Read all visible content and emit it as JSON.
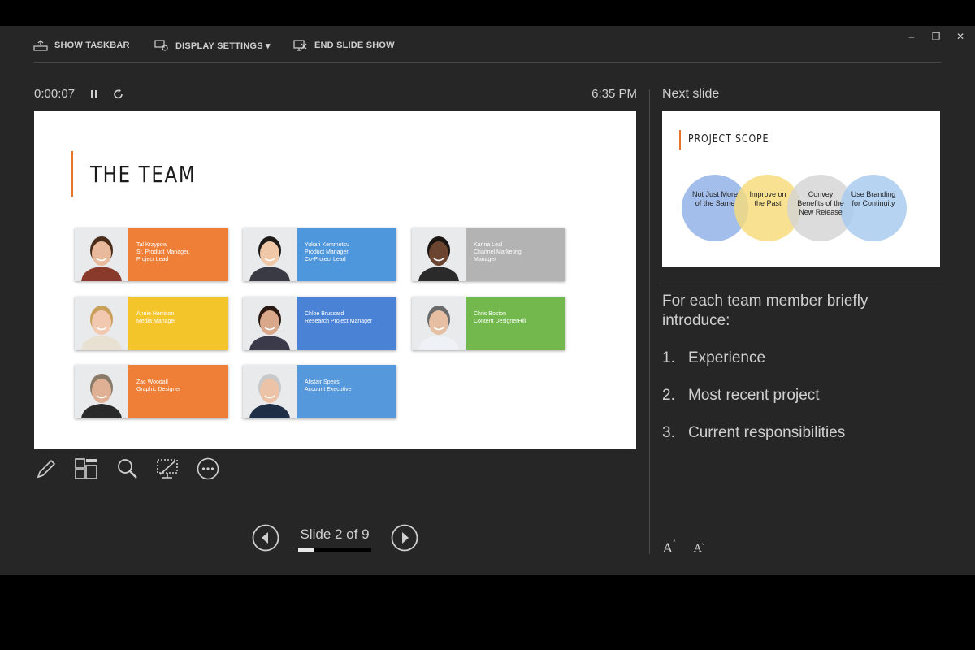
{
  "toolbar": {
    "show_taskbar": "SHOW TASKBAR",
    "display_settings": "DISPLAY SETTINGS ▾",
    "end_slide_show": "END SLIDE SHOW",
    "window_controls": [
      "–",
      "❐",
      "✕"
    ]
  },
  "presenter": {
    "timer": "0:00:07",
    "clock": "6:35 PM",
    "slide_counter": "Slide 2 of 9",
    "progress_fraction": 0.22
  },
  "current_slide": {
    "title": "THE TEAM",
    "accent_color": "#e8742c",
    "members": [
      {
        "text": "Tal Krzypow\nSr. Product Manager,\nProject Lead",
        "color": "#ef7f36"
      },
      {
        "text": "Yukari Kemmotsu\nProduct Manager,\nCo-Project Lead",
        "color": "#4f97dc"
      },
      {
        "text": "Karina Leal\nChannel Marketing\nManager",
        "color": "#b3b3b3"
      },
      {
        "text": "Annie Herrison\nMedia Manager",
        "color": "#f4c52a"
      },
      {
        "text": "Chloe Brussard\nResearch Project Manager",
        "color": "#4a82d6"
      },
      {
        "text": "Chris Boston\nContent DesignerHill",
        "color": "#72b84c"
      },
      {
        "text": "Zac Woodall\nGraphic Designer",
        "color": "#ef7f36"
      },
      {
        "text": "Alistair Speirs\nAccount Executive",
        "color": "#5598dc"
      }
    ]
  },
  "next_slide": {
    "label": "Next slide",
    "title": "PROJECT SCOPE",
    "circles": [
      {
        "text": "Not Just More of the Same",
        "color": "#8fb0e6"
      },
      {
        "text": "Improve on the Past",
        "color": "#f7dc7a"
      },
      {
        "text": "Convey Benefits of the New Release",
        "color": "#d4d4d4"
      },
      {
        "text": "Use Branding for Continuity",
        "color": "#a6c9ef"
      }
    ]
  },
  "notes": {
    "intro": "For each team member briefly introduce:",
    "items": [
      {
        "num": "1.",
        "text": "Experience"
      },
      {
        "num": "2.",
        "text": "Most recent project"
      },
      {
        "num": "3.",
        "text": "Current responsibilities"
      }
    ]
  },
  "icons": {
    "tools": [
      "pen-icon",
      "see-all-slides-icon",
      "zoom-icon",
      "black-screen-icon",
      "more-options-icon"
    ],
    "font_increase": "A",
    "font_decrease": "A"
  }
}
